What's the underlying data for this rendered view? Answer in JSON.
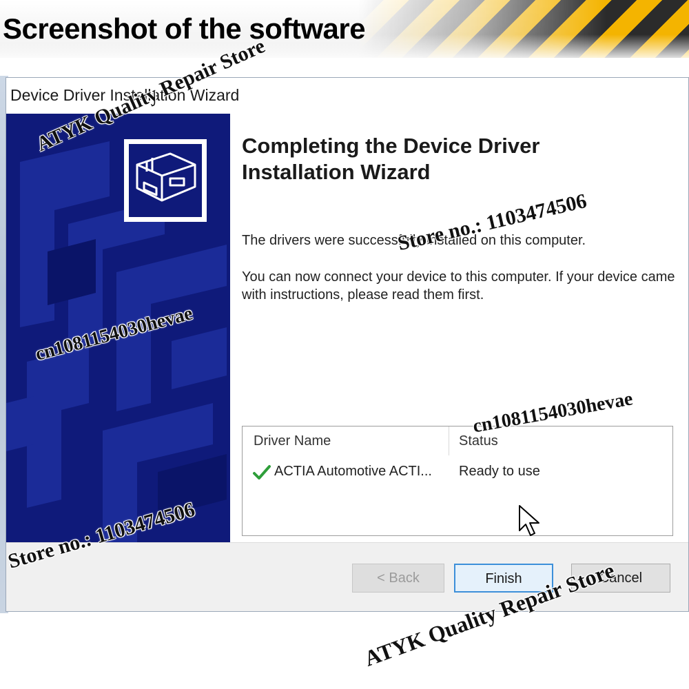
{
  "banner": {
    "title": "Screenshot of the software"
  },
  "window": {
    "title": "Device Driver Installation Wizard",
    "heading_line1": "Completing the Device Driver",
    "heading_line2": "Installation Wizard",
    "message1": "The drivers were successfully installed on this computer.",
    "message2": "You can now connect your device to this computer. If your device came with instructions, please read them first."
  },
  "driver_table": {
    "columns": [
      "Driver Name",
      "Status"
    ],
    "rows": [
      {
        "name": "ACTIA Automotive ACTI...",
        "status": "Ready to use",
        "icon": "checkmark-icon"
      }
    ]
  },
  "buttons": {
    "back": "< Back",
    "finish": "Finish",
    "cancel": "Cancel"
  },
  "watermarks": {
    "store_name": "ATYK Quality Repair Store",
    "store_no": "Store no.:  1103474506",
    "user_id": "cn1081154030hevae"
  },
  "colors": {
    "side_panel": "#0f1a7a",
    "focus_border": "#3c8fd9",
    "check_green": "#2e9e3a"
  }
}
